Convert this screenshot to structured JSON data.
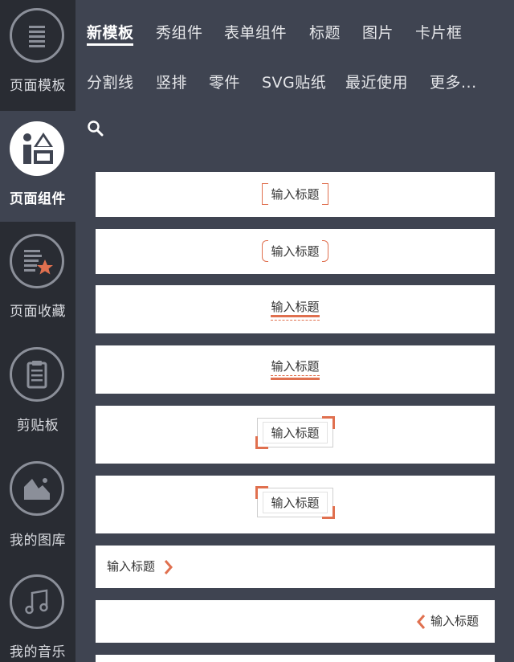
{
  "sidebar": {
    "items": [
      {
        "label": "页面模板",
        "icon": "page-template-icon",
        "active": false
      },
      {
        "label": "页面组件",
        "icon": "page-components-icon",
        "active": true
      },
      {
        "label": "页面收藏",
        "icon": "page-favorites-icon",
        "active": false
      },
      {
        "label": "剪贴板",
        "icon": "clipboard-icon",
        "active": false
      },
      {
        "label": "我的图库",
        "icon": "my-gallery-icon",
        "active": false
      },
      {
        "label": "我的音乐",
        "icon": "my-music-icon",
        "active": false
      }
    ]
  },
  "tabs": {
    "row1": [
      "新模板",
      "秀组件",
      "表单组件",
      "标题",
      "图片",
      "卡片框"
    ],
    "row2": [
      "分割线",
      "竖排",
      "零件",
      "SVG贴纸",
      "最近使用",
      "更多..."
    ],
    "active": "新模板"
  },
  "search": {
    "icon": "search-icon"
  },
  "components": {
    "title_text": "输入标题",
    "items": [
      {
        "style": "square-bracket"
      },
      {
        "style": "round-bracket"
      },
      {
        "style": "underline-solid-dash"
      },
      {
        "style": "underline-dash-solid"
      },
      {
        "style": "corner-frame-top-right"
      },
      {
        "style": "corner-frame-top-left"
      },
      {
        "style": "left-text-right-arrow"
      },
      {
        "style": "right-text-left-arrow"
      }
    ]
  },
  "colors": {
    "sidebar_bg": "#292c33",
    "main_bg": "#3f4451",
    "accent": "#e0704f"
  }
}
